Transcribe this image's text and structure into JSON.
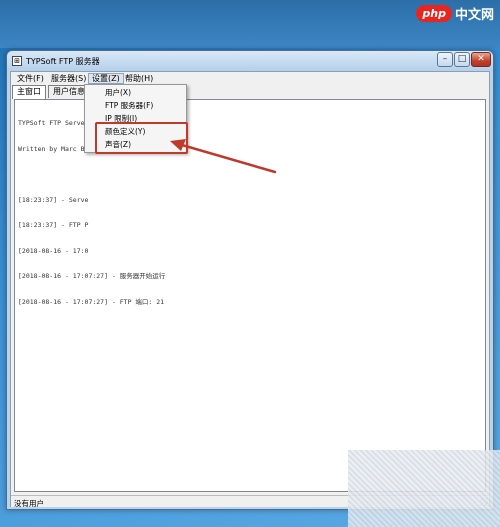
{
  "watermark": {
    "brand": "php",
    "site": "中文网"
  },
  "window": {
    "title": "TYPSoft FTP 服务器",
    "controls": {
      "minimize": "–",
      "maximize": "□",
      "close": "✕"
    }
  },
  "menubar": {
    "items": [
      {
        "label": "文件(F)"
      },
      {
        "label": "服务器(S)"
      },
      {
        "label": "设置(Z)"
      },
      {
        "label": "帮助(H)"
      }
    ]
  },
  "tabs": [
    {
      "label": "主窗口"
    },
    {
      "label": "用户信息"
    }
  ],
  "log": {
    "lines": [
      "TYPSoft FTP Server",
      "Written by Marc Be",
      "",
      "[18:23:37] - Serve",
      "[18:23:37] - FTP P",
      "[2018-08-16 - 17:0",
      "[2018-08-16 - 17:07:27] - 服务器开始运行",
      "[2018-08-16 - 17:07:27] - FTP 端口: 21"
    ]
  },
  "dropdown": {
    "items": [
      {
        "label": "用户(X)"
      },
      {
        "label": "FTP 服务器(F)"
      },
      {
        "label": "IP 限制(I)"
      },
      {
        "label": "颜色定义(Y)"
      },
      {
        "label": "声音(Z)"
      }
    ]
  },
  "statusbar": {
    "text": "没有用户"
  },
  "colors": {
    "highlight": "#c0392b",
    "accent": "#e8261f"
  }
}
